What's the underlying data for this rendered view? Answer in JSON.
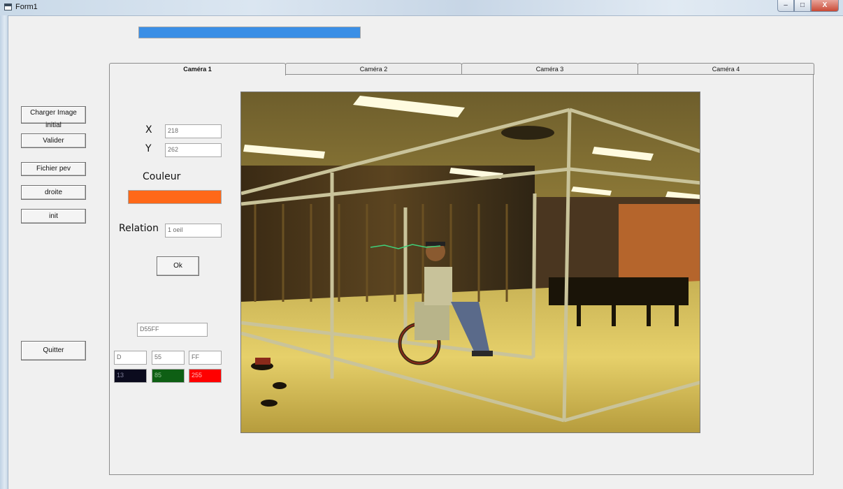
{
  "window": {
    "title": "Form1",
    "buttons": {
      "minimize": "–",
      "maximize": "□",
      "close": "X"
    }
  },
  "progress": {
    "value_fraction": 1.0,
    "color": "#3b8fe6"
  },
  "left_buttons": {
    "charger": "Charger Image initial",
    "valider": "Valider",
    "fichier": "Fichier pev",
    "droite": "droite",
    "init": "init",
    "quitter": "Quitter"
  },
  "tabs": [
    "Caméra 1",
    "Caméra 2",
    "Caméra 3",
    "Caméra 4"
  ],
  "active_tab": 0,
  "coords": {
    "x_label": "X",
    "x_value": "218",
    "y_label": "Y",
    "y_value": "262"
  },
  "couleur": {
    "label": "Couleur",
    "color": "#ff6818"
  },
  "relation": {
    "label": "Relation",
    "value": "1 oeil"
  },
  "ok_button": "Ok",
  "hex_field": "D55FF",
  "hex_parts": [
    "D",
    "55",
    "FF"
  ],
  "rgb_swatches": [
    {
      "value": "13",
      "bg": "#0b0b1e",
      "fg": "#7f7f9a"
    },
    {
      "value": "85",
      "bg": "#0e5f14",
      "fg": "#8fbf8f"
    },
    {
      "value": "255",
      "bg": "#ff0000",
      "fg": "#ffbcbc"
    }
  ]
}
